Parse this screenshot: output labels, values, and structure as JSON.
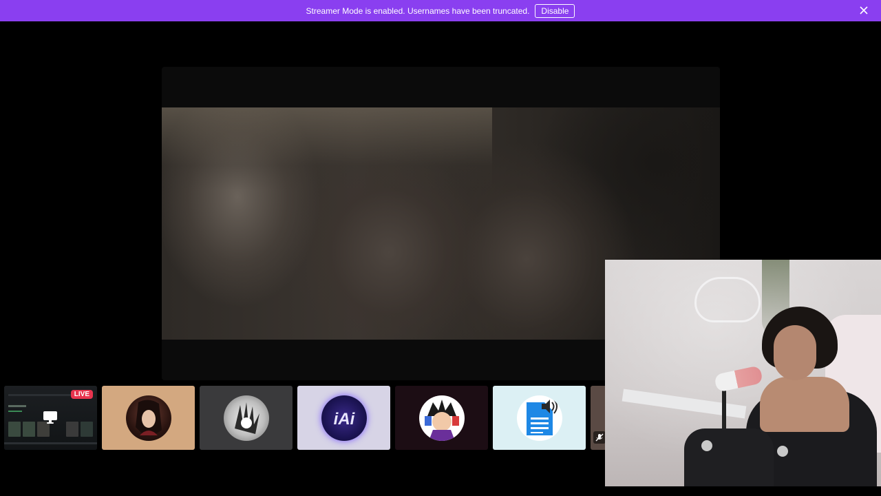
{
  "banner": {
    "message": "Streamer Mode is enabled. Usernames have been truncated.",
    "disable_label": "Disable",
    "bg_color": "#8a3ff0"
  },
  "participants": [
    {
      "kind": "screen-share",
      "badge": "LIVE",
      "bg": "#1a1d20"
    },
    {
      "kind": "avatar",
      "bg": "#d3a880"
    },
    {
      "kind": "avatar",
      "bg": "#3a3a3c"
    },
    {
      "kind": "avatar",
      "bg": "#d7d4e6"
    },
    {
      "kind": "avatar",
      "bg": "#1c0d14"
    },
    {
      "kind": "avatar",
      "bg": "#dcf0f4"
    },
    {
      "kind": "avatar-muted",
      "bg": "#5a4a44"
    }
  ],
  "icons": {
    "close": "close-icon",
    "screen": "monitor-icon",
    "doc": "document-speaker-icon",
    "mute": "mic-muted-icon"
  }
}
